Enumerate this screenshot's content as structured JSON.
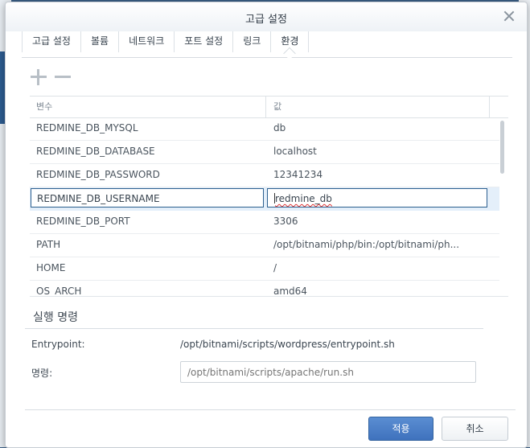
{
  "dialog": {
    "title": "고급 설정"
  },
  "tabs": [
    {
      "label": "고급 설정",
      "active": false
    },
    {
      "label": "볼륨",
      "active": false
    },
    {
      "label": "네트워크",
      "active": false
    },
    {
      "label": "포트 설정",
      "active": false
    },
    {
      "label": "링크",
      "active": false
    },
    {
      "label": "환경",
      "active": true
    }
  ],
  "toolbar": {
    "add_icon": "plus-icon",
    "remove_icon": "minus-icon"
  },
  "env_table": {
    "columns": [
      "변수",
      "값"
    ],
    "rows": [
      {
        "key": "REDMINE_DB_MYSQL",
        "value": "db"
      },
      {
        "key": "REDMINE_DB_DATABASE",
        "value": "localhost"
      },
      {
        "key": "REDMINE_DB_PASSWORD",
        "value": "12341234"
      },
      {
        "key": "REDMINE_DB_USERNAME",
        "value": "redmine_db",
        "selected": true,
        "editing": true
      },
      {
        "key": "REDMINE_DB_PORT",
        "value": "3306"
      },
      {
        "key": "PATH",
        "value": "/opt/bitnami/php/bin:/opt/bitnami/ph..."
      },
      {
        "key": "HOME",
        "value": "/"
      },
      {
        "key": "OS_ARCH",
        "value": "amd64"
      }
    ]
  },
  "exec": {
    "section_title": "실행 명령",
    "entrypoint_label": "Entrypoint:",
    "entrypoint_value": "/opt/bitnami/scripts/wordpress/entrypoint.sh",
    "command_label": "명령:",
    "command_placeholder": "/opt/bitnami/scripts/apache/run.sh"
  },
  "footer": {
    "apply_label": "적용",
    "cancel_label": "취소"
  },
  "colors": {
    "primary": "#4a7fc6",
    "selection": "#e4effa",
    "edit_border": "#2c5f8f"
  }
}
